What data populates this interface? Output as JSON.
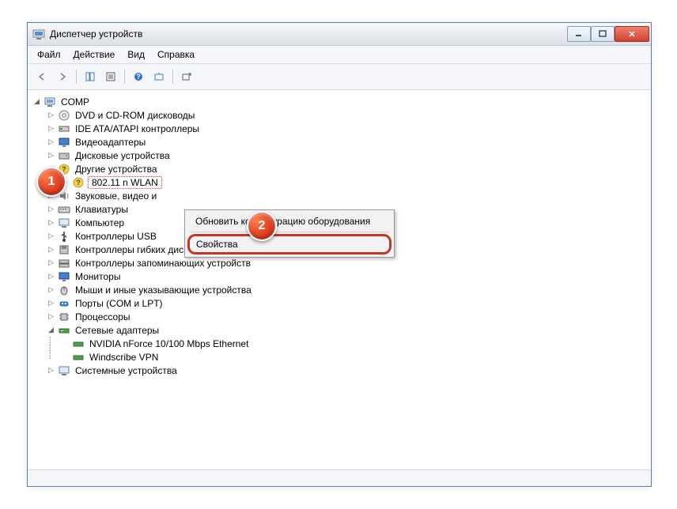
{
  "window": {
    "title": "Диспетчер устройств"
  },
  "menu": {
    "file": "Файл",
    "action": "Действие",
    "view": "Вид",
    "help": "Справка"
  },
  "tree": {
    "root": "COMP",
    "n0": "DVD и CD-ROM дисководы",
    "n1": "IDE ATA/ATAPI контроллеры",
    "n2": "Видеоадаптеры",
    "n3": "Дисковые устройства",
    "n4": "Другие устройства",
    "n4_0": "802.11 n WLAN",
    "n5": "Звуковые, видео и",
    "n6": "Клавиатуры",
    "n7": "Компьютер",
    "n8": "Контроллеры USB",
    "n9": "Контроллеры гибких дисков",
    "n10": "Контроллеры запоминающих устройств",
    "n11": "Мониторы",
    "n12": "Мыши и иные указывающие устройства",
    "n13": "Порты (COM и LPT)",
    "n14": "Процессоры",
    "n15": "Сетевые адаптеры",
    "n15_0": "NVIDIA nForce 10/100 Mbps Ethernet",
    "n15_1": "Windscribe VPN",
    "n16": "Системные устройства"
  },
  "context": {
    "scan": "Обновить конфигурацию оборудования",
    "properties": "Свойства"
  },
  "callout": {
    "one": "1",
    "two": "2"
  }
}
